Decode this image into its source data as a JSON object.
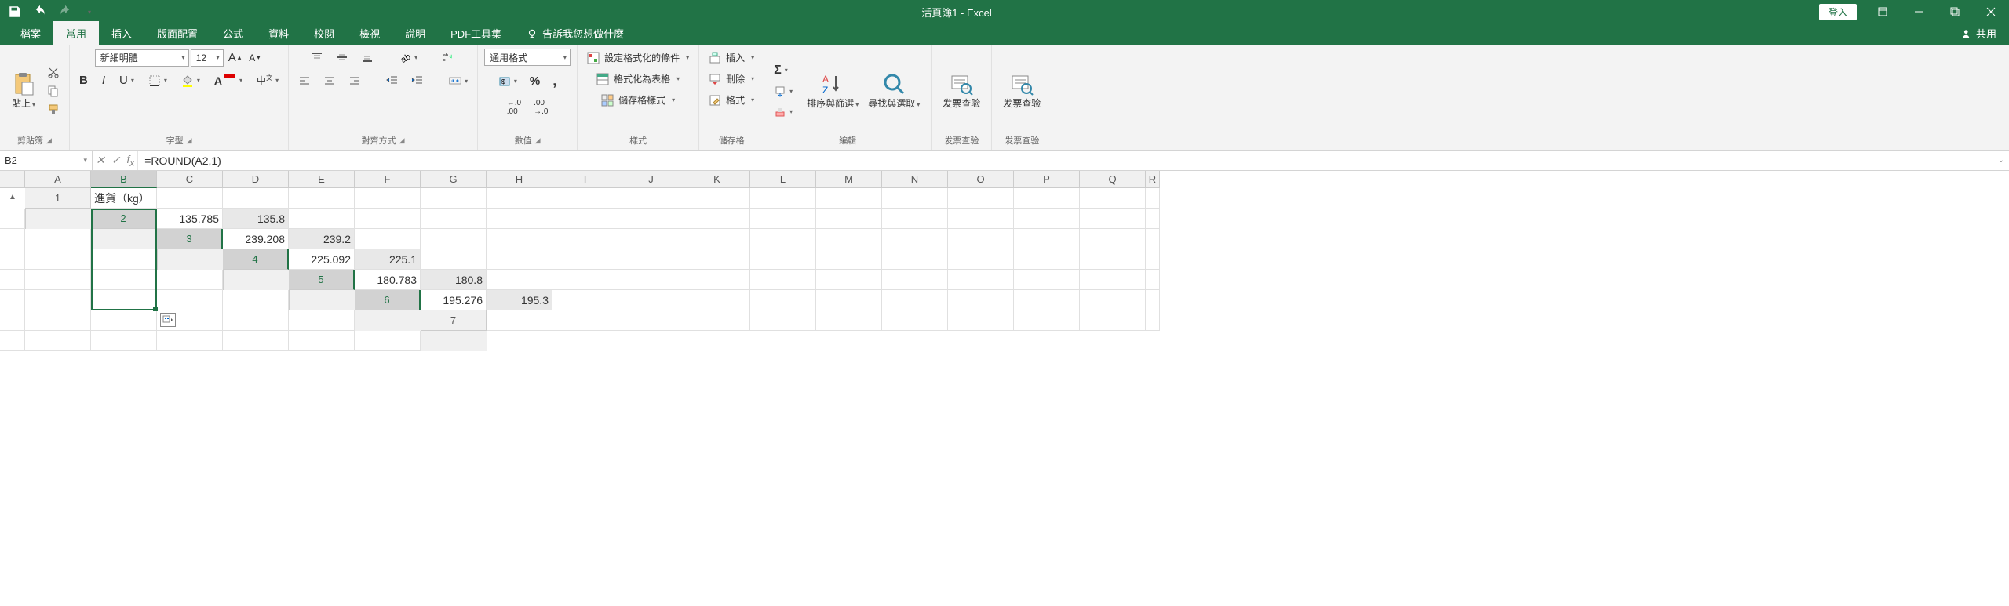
{
  "title": "活頁簿1 - Excel",
  "signin": "登入",
  "share": "共用",
  "tabs": [
    "檔案",
    "常用",
    "插入",
    "版面配置",
    "公式",
    "資料",
    "校閱",
    "檢視",
    "說明",
    "PDF工具集"
  ],
  "tellme": "告訴我您想做什麼",
  "ribbon": {
    "clipboard": {
      "paste": "貼上",
      "label": "剪貼簿"
    },
    "font": {
      "name": "新細明體",
      "size": "12",
      "label": "字型"
    },
    "align": {
      "label": "對齊方式"
    },
    "number": {
      "format": "通用格式",
      "label": "數值"
    },
    "styles": {
      "cond": "設定格式化的條件",
      "table": "格式化為表格",
      "cell": "儲存格樣式",
      "label": "樣式"
    },
    "cells": {
      "insert": "插入",
      "delete": "刪除",
      "format": "格式",
      "label": "儲存格"
    },
    "editing": {
      "sort": "排序與篩選",
      "find": "尋找與選取",
      "label": "編輯"
    },
    "invoice1": {
      "btn": "发票查验",
      "label": "发票查验"
    },
    "invoice2": {
      "btn": "发票查验",
      "label": "发票查验"
    }
  },
  "namebox": "B2",
  "formula": "=ROUND(A2,1)",
  "columns": [
    "A",
    "B",
    "C",
    "D",
    "E",
    "F",
    "G",
    "H",
    "I",
    "J",
    "K",
    "L",
    "M",
    "N",
    "O",
    "P",
    "Q",
    "R"
  ],
  "rows": [
    "1",
    "2",
    "3",
    "4",
    "5",
    "6",
    "7"
  ],
  "chart_data": {
    "type": "table",
    "headers_row1": {
      "A": "進貨（kg）"
    },
    "data": {
      "A": [
        135.785,
        239.208,
        225.092,
        180.783,
        195.276
      ],
      "B": [
        135.8,
        239.2,
        225.1,
        180.8,
        195.3
      ]
    }
  }
}
